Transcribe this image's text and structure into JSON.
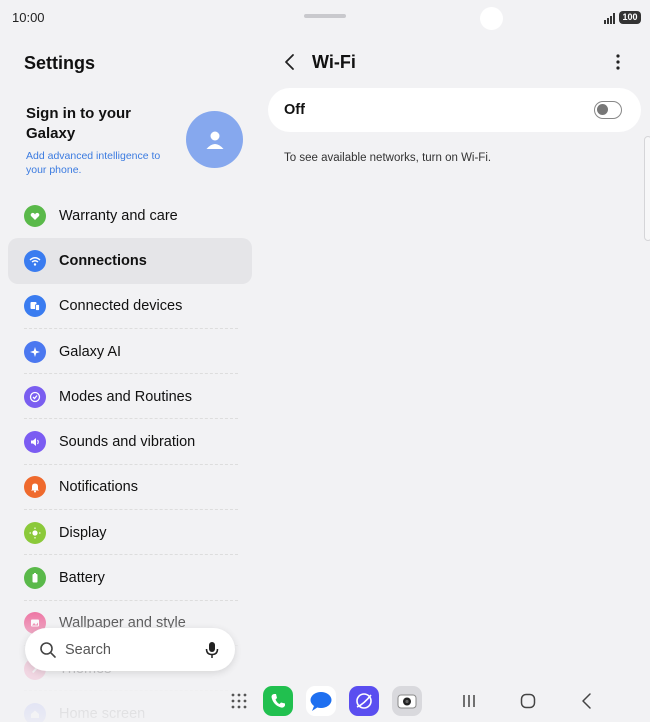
{
  "status": {
    "time": "10:00",
    "battery": "100"
  },
  "left": {
    "title": "Settings",
    "account": {
      "title": "Sign in to your Galaxy",
      "subtitle": "Add advanced intelligence to your phone."
    },
    "items": [
      {
        "label": "Warranty and care",
        "icon": "heart-shield-icon",
        "color": "#5ab94a"
      },
      {
        "label": "Connections",
        "icon": "wifi-icon",
        "color": "#3a7cf0",
        "active": true
      },
      {
        "label": "Connected devices",
        "icon": "devices-icon",
        "color": "#3a7cf0"
      },
      {
        "label": "Galaxy AI",
        "icon": "sparkle-icon",
        "color": "#4b78f0"
      },
      {
        "label": "Modes and Routines",
        "icon": "check-circle-icon",
        "color": "#7a5ef0"
      },
      {
        "label": "Sounds and vibration",
        "icon": "speaker-icon",
        "color": "#7b5cf2"
      },
      {
        "label": "Notifications",
        "icon": "bell-icon",
        "color": "#ef6a2d"
      },
      {
        "label": "Display",
        "icon": "sun-icon",
        "color": "#8bc93a"
      },
      {
        "label": "Battery",
        "icon": "battery-icon",
        "color": "#5ab94a"
      },
      {
        "label": "Wallpaper and style",
        "icon": "image-icon",
        "color": "#ec5b92"
      },
      {
        "label": "Themes",
        "icon": "brush-icon",
        "color": "#ec5b92"
      },
      {
        "label": "Home screen",
        "icon": "home-icon",
        "color": "#5b6ef0"
      }
    ],
    "search": {
      "placeholder": "Search"
    }
  },
  "right": {
    "title": "Wi-Fi",
    "wifi_state": "Off",
    "hint": "To see available networks, turn on Wi-Fi."
  },
  "dock": [
    {
      "name": "apps-grid-icon"
    },
    {
      "name": "phone-app-icon",
      "color": "#21c04f"
    },
    {
      "name": "messages-app-icon",
      "color": "#1e6ff0"
    },
    {
      "name": "internet-app-icon",
      "color": "#5a4ef0"
    },
    {
      "name": "camera-app-icon",
      "color": "#cfcfd4"
    }
  ]
}
